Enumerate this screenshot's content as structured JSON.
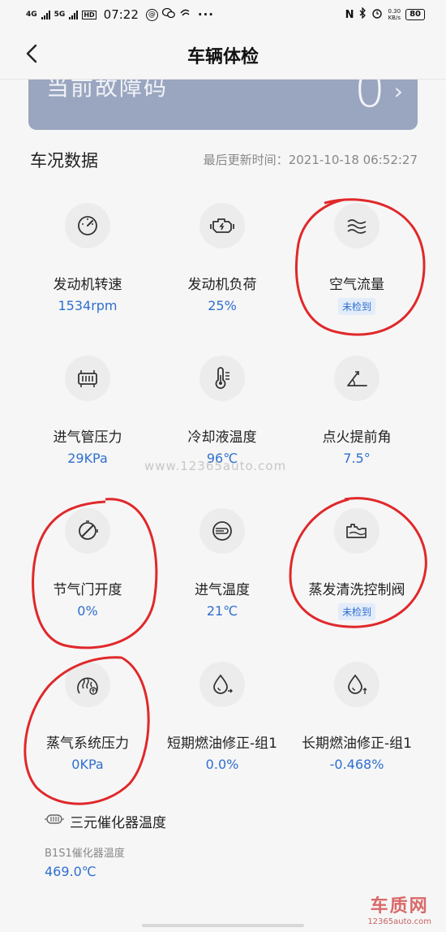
{
  "status_bar": {
    "net1": "4G",
    "net2": "5G",
    "hd": "HD",
    "time": "07:22",
    "more": "···",
    "speed_value": "0.30",
    "speed_unit": "KB/s",
    "battery": "80"
  },
  "header": {
    "title": "车辆体检"
  },
  "fault": {
    "label": "当前故障码",
    "count": "0"
  },
  "section": {
    "title": "车况数据",
    "update_label": "最后更新时间：",
    "update_time": "2021-10-18 06:52:27"
  },
  "metrics": [
    {
      "icon": "speedometer-icon",
      "label": "发动机转速",
      "value": "1534rpm"
    },
    {
      "icon": "engine-icon",
      "label": "发动机负荷",
      "value": "25%"
    },
    {
      "icon": "airflow-icon",
      "label": "空气流量",
      "badge": "未检到"
    },
    {
      "icon": "manifold-icon",
      "label": "进气管压力",
      "value": "29KPa"
    },
    {
      "icon": "coolant-thermometer-icon",
      "label": "冷却液温度",
      "value": "96℃"
    },
    {
      "icon": "ignition-angle-icon",
      "label": "点火提前角",
      "value": "7.5°"
    },
    {
      "icon": "throttle-icon",
      "label": "节气门开度",
      "value": "0%"
    },
    {
      "icon": "intake-temp-icon",
      "label": "进气温度",
      "value": "21℃"
    },
    {
      "icon": "evap-purge-icon",
      "label": "蒸发清洗控制阀",
      "badge": "未检到"
    },
    {
      "icon": "vapor-pressure-icon",
      "label": "蒸气系统压力",
      "value": "0KPa"
    },
    {
      "icon": "fuel-drop-icon",
      "label": "短期燃油修正-组1",
      "value": "0.0%"
    },
    {
      "icon": "fuel-drop-up-icon",
      "label": "长期燃油修正-组1",
      "value": "-0.468%"
    }
  ],
  "catalyst": {
    "title": "三元催化器温度",
    "sublabel": "B1S1催化器温度",
    "value": "469.0℃"
  },
  "watermark": "www.12365auto.com",
  "brand": {
    "name": "车质网",
    "url": "12365auto.com"
  },
  "colors": {
    "accent_blue": "#2f6fcf",
    "annotation_red": "#e0282a",
    "fault_card": "#9aa6bf"
  }
}
